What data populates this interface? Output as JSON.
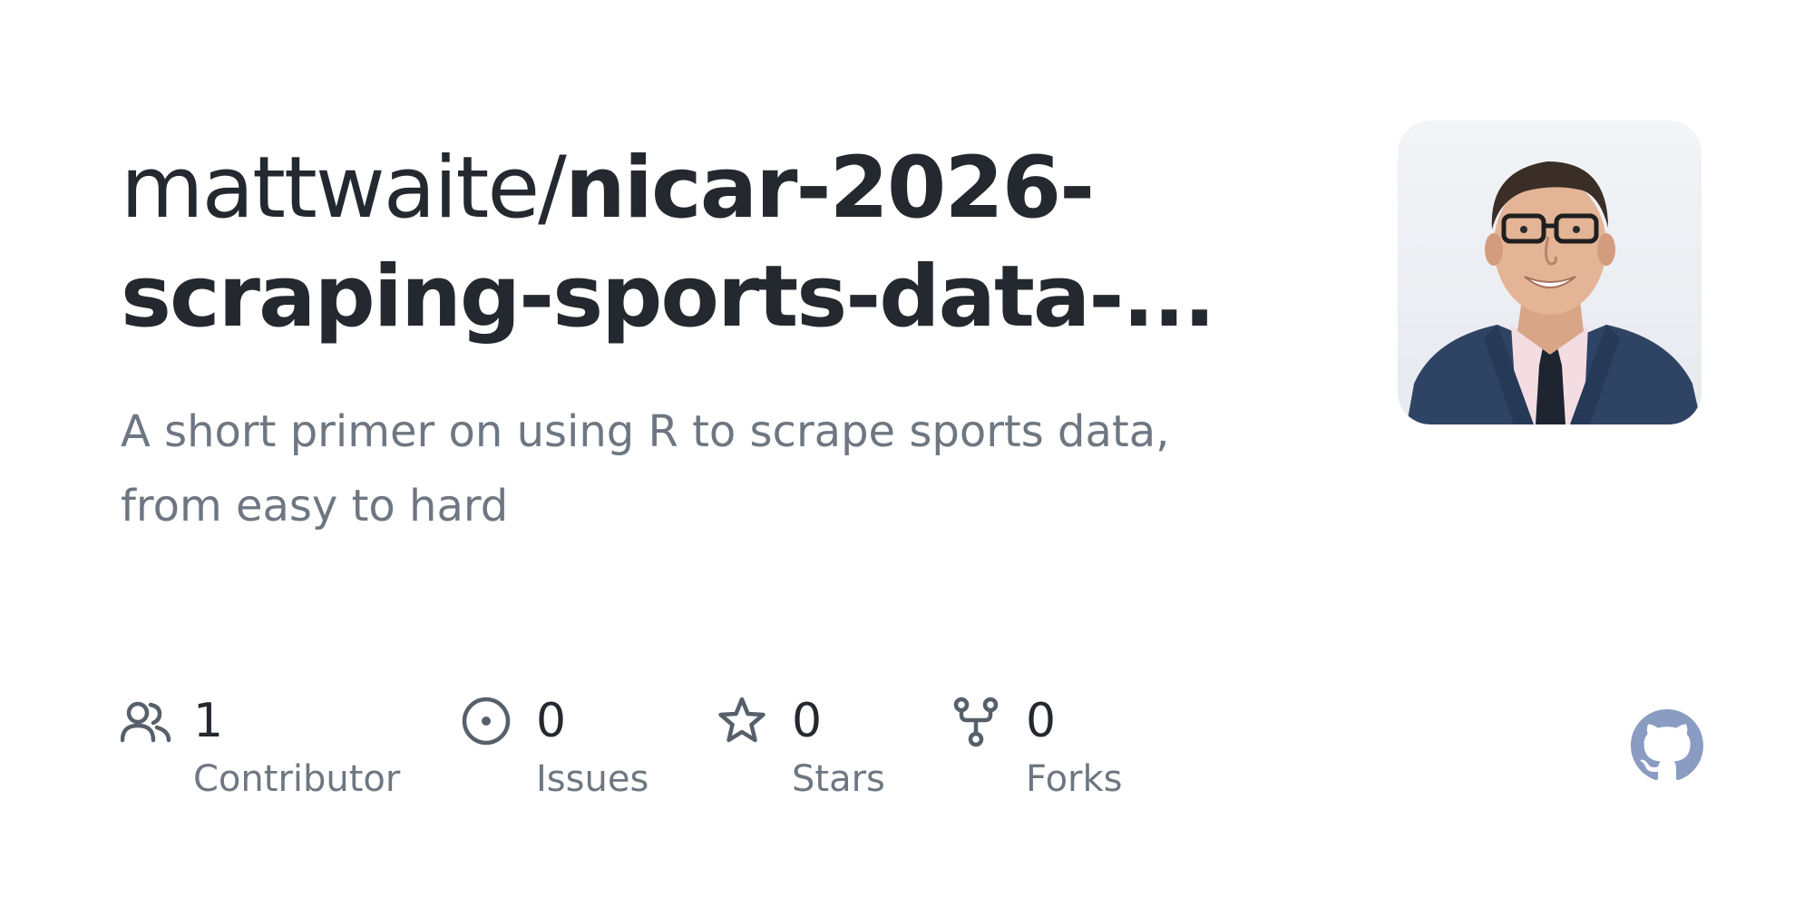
{
  "repo": {
    "owner_prefix": "mattwaite/",
    "name": "nicar-2026-scraping-sports-data-...",
    "description": "A short primer on using R to scrape sports data, from easy to hard"
  },
  "avatar": {
    "alt": "mattwaite avatar"
  },
  "stats": {
    "contributors": {
      "count": "1",
      "label": "Contributor",
      "icon": "people-icon"
    },
    "issues": {
      "count": "0",
      "label": "Issues",
      "icon": "issue-opened-icon"
    },
    "stars": {
      "count": "0",
      "label": "Stars",
      "icon": "star-icon"
    },
    "forks": {
      "count": "0",
      "label": "Forks",
      "icon": "repo-forked-icon"
    }
  },
  "colors": {
    "title": "#24292f",
    "muted": "#6e7781",
    "icon": "#57606a",
    "github_mark": "#8b9cc3"
  },
  "branding": {
    "logo": "github-mark-icon"
  }
}
